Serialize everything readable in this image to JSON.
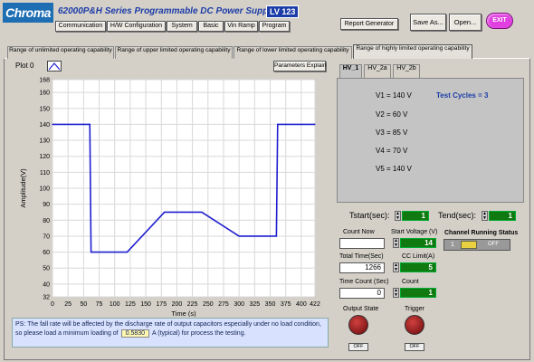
{
  "app": {
    "logo": "Chroma",
    "title": "62000P&H Series  Programmable DC Power Supply",
    "version": "LV 123"
  },
  "menu": [
    "Communication",
    "H/W Configuration",
    "System",
    "Basic",
    "Vin Ramp",
    "Program"
  ],
  "toolbar": {
    "report": "Report Generator",
    "save_as": "Save As...",
    "open": "Open...",
    "exit": "EXIT"
  },
  "tabs": [
    "Range of unlimited operating capability",
    "Range of upper limited operating capability",
    "Range of lower limited operating capability",
    "Range of highly limited operating capability"
  ],
  "plot": {
    "label": "Plot 0",
    "params_button": "Parameters Explain"
  },
  "subtabs": [
    "HV_1",
    "HV_2a",
    "HV_2b"
  ],
  "voltages": [
    "V1 = 140 V",
    "V2 = 60 V",
    "V3 = 85 V",
    "V4 = 70 V",
    "V5 = 140 V"
  ],
  "test_cycles": "Test Cycles = 3",
  "controls": {
    "tstart_label": "Tstart(sec):",
    "tstart_value": "1",
    "tend_label": "Tend(sec):",
    "tend_value": "1",
    "count_now_label": "Count Now",
    "count_now_value": "",
    "start_voltage_label": "Start Voltage (V)",
    "start_voltage_value": "14",
    "channel_status_label": "Channel Running Status",
    "channel_number": "1",
    "channel_state": "OFF",
    "total_time_label": "Total Time(Sec)",
    "total_time_value": "1266",
    "cc_limit_label": "CC Limit(A)",
    "cc_limit_value": "5",
    "time_count_label": "Time Count (Sec)",
    "time_count_value": "0",
    "count_label": "Count",
    "count_value": "1",
    "output_state_label": "Output State",
    "output_state_value": "OFF",
    "trigger_label": "Trigger",
    "trigger_value": "OFF"
  },
  "note": {
    "prefix": "PS: The fall rate will be affected by the discharge rate of output capacitors especially under no load condition, so please load a minimum loading of",
    "value": "0.5830",
    "suffix": "A (typical) for process the testing."
  },
  "colors": {
    "accent": "#1c3ca8",
    "trace": "#1f1fd0",
    "indicator": "#107a10",
    "exit": "#e040e0"
  },
  "chart_data": {
    "type": "line",
    "xlabel": "Time (s)",
    "ylabel": "Amplitude(V)",
    "xlim": [
      0,
      422
    ],
    "ylim": [
      32,
      168
    ],
    "xticks": [
      0,
      25,
      50,
      75,
      100,
      125,
      150,
      175,
      200,
      225,
      250,
      275,
      300,
      325,
      350,
      375,
      400,
      422
    ],
    "yticks": [
      32,
      40,
      50,
      60,
      70,
      80,
      90,
      100,
      110,
      120,
      130,
      140,
      150,
      160,
      168
    ],
    "grid": true,
    "series": [
      {
        "x": [
          0,
          60,
          62,
          120,
          180,
          240,
          300,
          360,
          362,
          422
        ],
        "y": [
          140,
          140,
          60,
          60,
          85,
          85,
          70,
          70,
          140,
          140
        ]
      }
    ]
  }
}
